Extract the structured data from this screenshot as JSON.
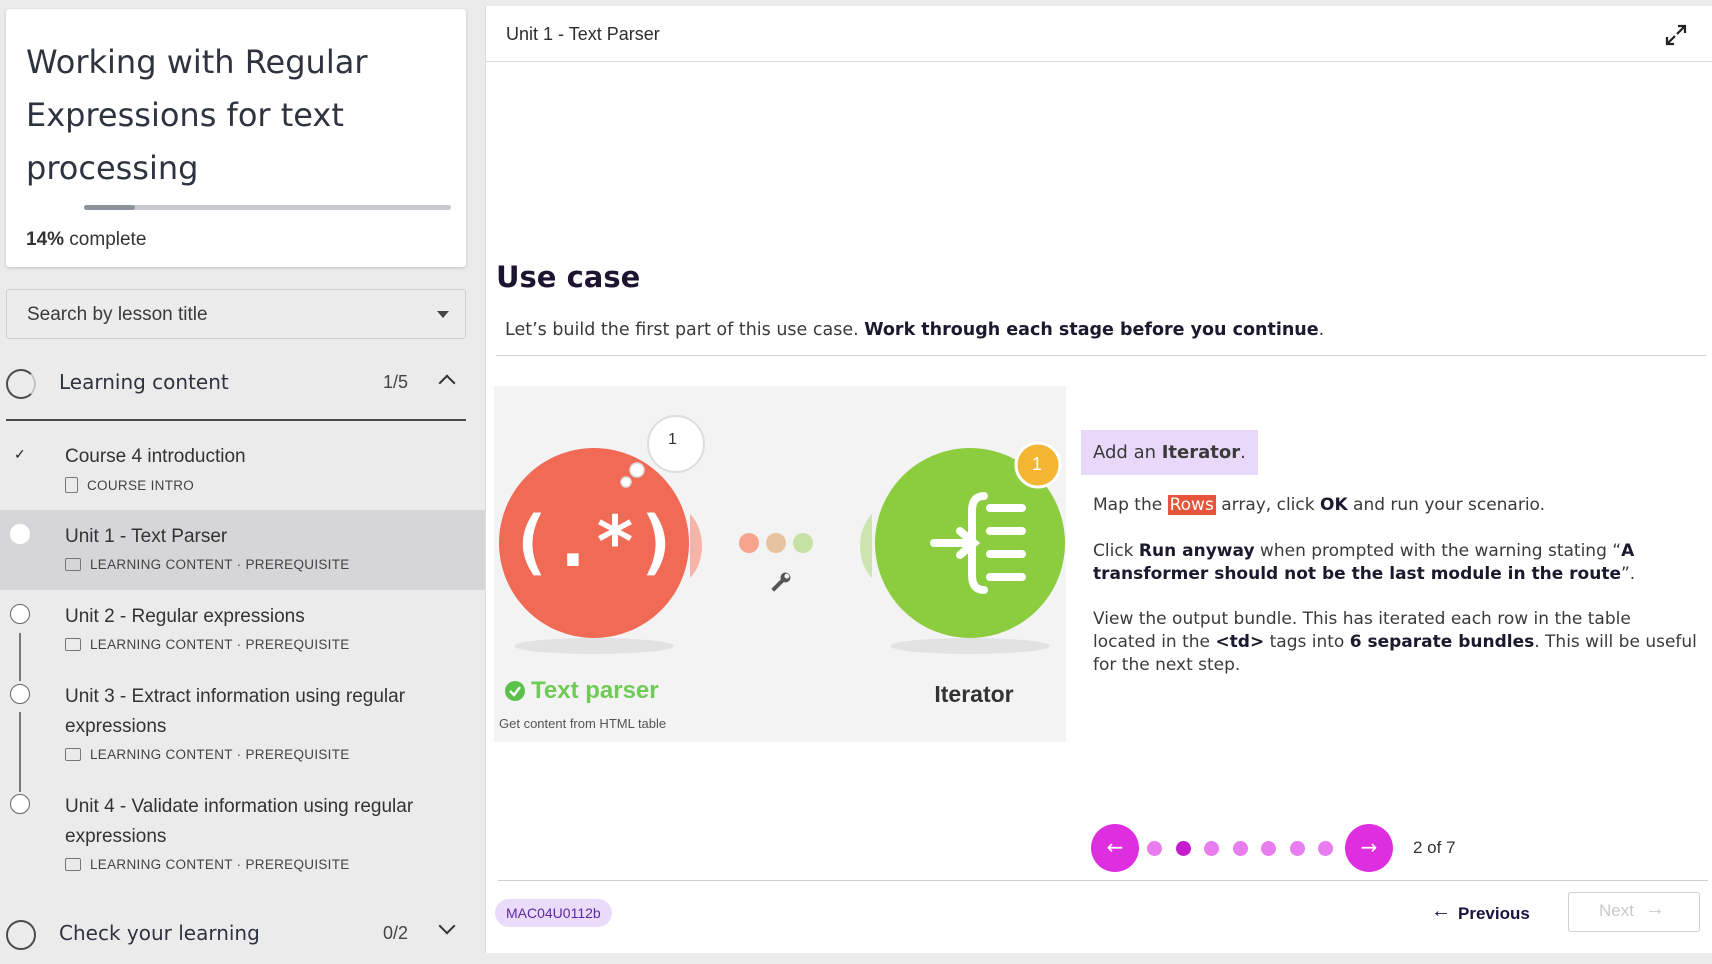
{
  "course": {
    "title": "Working with Regular Expressions for text processing",
    "progress_percent": "14%",
    "progress_suffix": " complete",
    "progress_fraction": 0.14
  },
  "search": {
    "placeholder": "Search by lesson title"
  },
  "sections": [
    {
      "title": "Learning content",
      "count": "1/5",
      "expanded": true,
      "lessons": [
        {
          "name": "Course 4 introduction",
          "meta": "COURSE INTRO",
          "status": "done"
        },
        {
          "name": "Unit 1 - Text Parser",
          "meta": "LEARNING CONTENT · PREREQUISITE",
          "status": "current"
        },
        {
          "name": "Unit 2 - Regular expressions",
          "meta": "LEARNING CONTENT · PREREQUISITE",
          "status": "todo"
        },
        {
          "name": "Unit 3 - Extract information using regular expressions",
          "meta": "LEARNING CONTENT · PREREQUISITE",
          "status": "todo"
        },
        {
          "name": "Unit 4 - Validate information using regular expressions",
          "meta": "LEARNING CONTENT · PREREQUISITE",
          "status": "todo"
        }
      ]
    },
    {
      "title": "Check your learning",
      "count": "0/2",
      "expanded": false
    }
  ],
  "main": {
    "unit_title": "Unit 1 - Text Parser",
    "heading": "Use case",
    "intro_plain": "Let’s build the first part of this use case. ",
    "intro_bold": "Work through each stage before you continue",
    "intro_end": ".",
    "figure": {
      "left_module_label": "Text parser",
      "left_module_sublabel": "Get content from HTML table",
      "left_bubble": "1",
      "right_module_label": "Iterator",
      "right_badge": "1"
    },
    "step": {
      "callout_plain": "Add an ",
      "callout_bold": "Iterator",
      "callout_end": ".",
      "p1_a": "Map the ",
      "p1_tag": "Rows",
      "p1_b": " array, click ",
      "p1_bold": "OK",
      "p1_c": " and run your scenario.",
      "p2_a": "Click ",
      "p2_bold1": "Run anyway",
      "p2_b": " when prompted with the warning stating “",
      "p2_bold2": "A transformer should not be the last module in the route",
      "p2_c": "”.",
      "p3_a": "View the output bundle. This has iterated each row in the table located in the ",
      "p3_bold1": "<td>",
      "p3_b": " tags into ",
      "p3_bold2": "6 separate bundles",
      "p3_c": ". This will be useful for the next step."
    },
    "pager": {
      "current": 2,
      "total": 7,
      "label": "2 of 7"
    },
    "footer": {
      "code": "MAC04U0112b",
      "previous_label": "Previous",
      "next_label": "Next"
    }
  },
  "colors": {
    "accent": "#dd2fe0",
    "accent_dark": "#c51ccb",
    "callout_bg": "#e8d8fa",
    "rows_tag": "#e5553b",
    "text_parser_red": "#f06a55",
    "iterator_green": "#8ccc3f"
  },
  "icons": [
    "check-icon",
    "document-icon",
    "slide-icon",
    "caret-down-icon",
    "chevron-up-icon",
    "chevron-down-icon",
    "expand-icon",
    "arrow-left-icon",
    "arrow-right-icon",
    "wrench-icon",
    "regex-icon",
    "iterator-icon"
  ]
}
